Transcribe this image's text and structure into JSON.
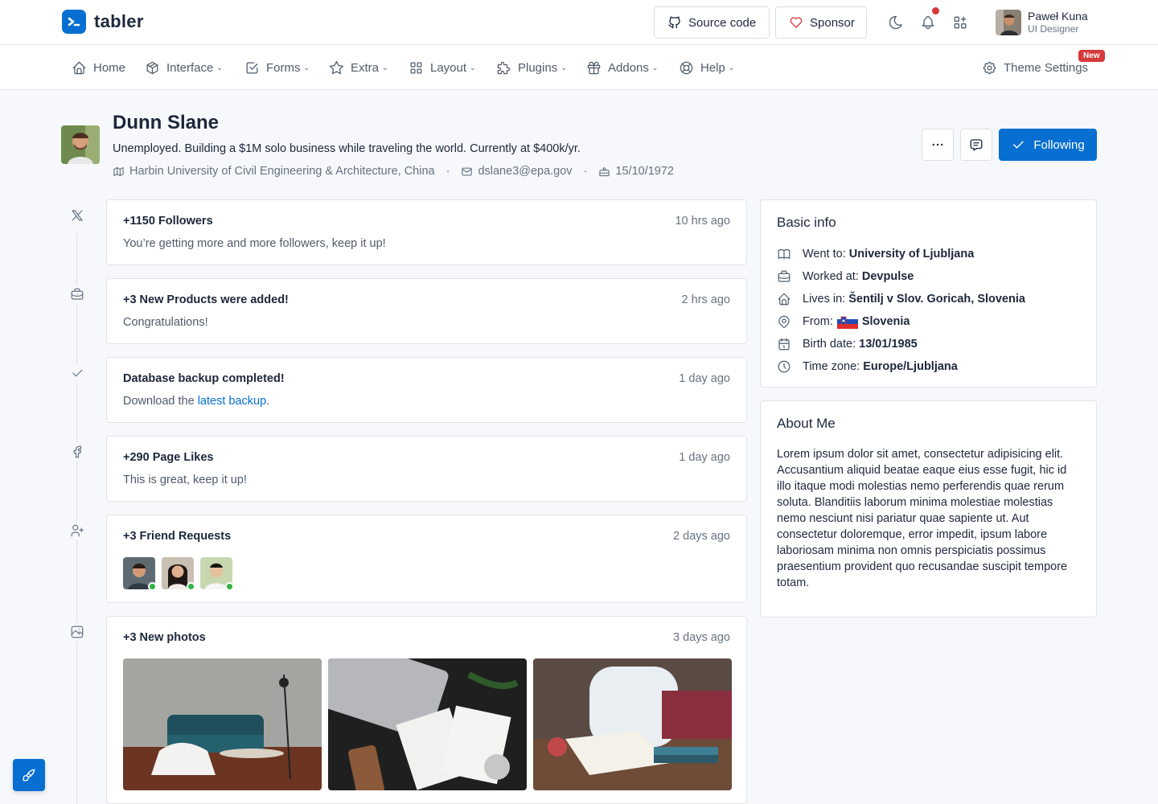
{
  "brand": {
    "name": "tabler",
    "accent": "#066fd1"
  },
  "topbar": {
    "source_code": "Source code",
    "sponsor": "Sponsor",
    "user": {
      "name": "Paweł Kuna",
      "role": "UI Designer"
    }
  },
  "nav": {
    "items": [
      {
        "label": "Home",
        "icon": "home-icon"
      },
      {
        "label": "Interface",
        "icon": "package-icon"
      },
      {
        "label": "Forms",
        "icon": "checkbox-icon"
      },
      {
        "label": "Extra",
        "icon": "star-icon"
      },
      {
        "label": "Layout",
        "icon": "layout-grid-icon"
      },
      {
        "label": "Plugins",
        "icon": "puzzle-icon"
      },
      {
        "label": "Addons",
        "icon": "gift-icon"
      },
      {
        "label": "Help",
        "icon": "lifebuoy-icon"
      }
    ],
    "theme_settings": "Theme Settings",
    "new_badge": "New"
  },
  "profile": {
    "name": "Dunn Slane",
    "bio": "Unemployed. Building a $1M solo business while traveling the world. Currently at $400k/yr.",
    "university": "Harbin University of Civil Engineering & Architecture, China",
    "email": "dslane3@epa.gov",
    "birthday": "15/10/1972",
    "following_label": "Following"
  },
  "timeline": [
    {
      "title": "+1150 Followers",
      "time": "10 hrs ago",
      "text": "You’re getting more and more followers, keep it up!",
      "icon": "x-brand-icon"
    },
    {
      "title": "+3 New Products were added!",
      "time": "2 hrs ago",
      "text": "Congratulations!",
      "icon": "briefcase-icon"
    },
    {
      "title": "Database backup completed!",
      "time": "1 day ago",
      "text_before": "Download the ",
      "link": "latest backup",
      "text_after": ".",
      "icon": "check-icon"
    },
    {
      "title": "+290 Page Likes",
      "time": "1 day ago",
      "text": "This is great, keep it up!",
      "icon": "facebook-icon"
    },
    {
      "title": "+3 Friend Requests",
      "time": "2 days ago",
      "icon": "user-plus-icon"
    },
    {
      "title": "+3 New photos",
      "time": "3 days ago",
      "icon": "photo-icon"
    }
  ],
  "basic_info": {
    "title": "Basic info",
    "rows": [
      {
        "label": "Went to:",
        "value": "University of Ljubljana",
        "icon": "book-icon"
      },
      {
        "label": "Worked at:",
        "value": "Devpulse",
        "icon": "briefcase-icon"
      },
      {
        "label": "Lives in:",
        "value": "Šentilj v Slov. Goricah, Slovenia",
        "icon": "home-icon"
      },
      {
        "label": "From:",
        "value": "Slovenia",
        "icon": "map-pin-icon"
      },
      {
        "label": "Birth date:",
        "value": "13/01/1985",
        "icon": "calendar-icon"
      },
      {
        "label": "Time zone:",
        "value": "Europe/Ljubljana",
        "icon": "clock-icon"
      }
    ]
  },
  "about": {
    "title": "About Me",
    "text": "Lorem ipsum dolor sit amet, consectetur adipisicing elit. Accusantium aliquid beatae eaque eius esse fugit, hic id illo itaque modi molestias nemo perferendis quae rerum soluta. Blanditiis laborum minima molestiae molestias nemo nesciunt nisi pariatur quae sapiente ut. Aut consectetur doloremque, error impedit, ipsum labore laboriosam minima non omnis perspiciatis possimus praesentium provident quo recusandae suscipit tempore totam."
  }
}
